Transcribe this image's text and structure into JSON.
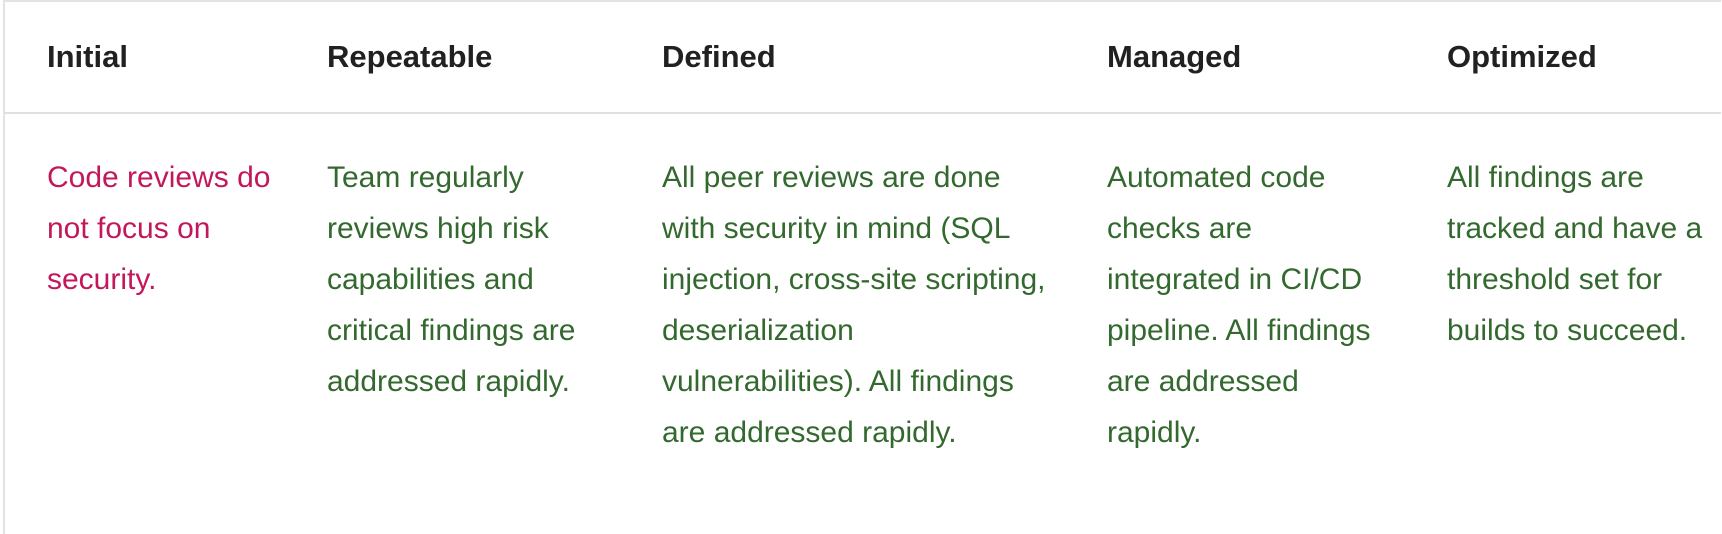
{
  "columns": [
    {
      "key": "initial",
      "header": "Initial"
    },
    {
      "key": "repeatable",
      "header": "Repeatable"
    },
    {
      "key": "defined",
      "header": "Defined"
    },
    {
      "key": "managed",
      "header": "Managed"
    },
    {
      "key": "optimized",
      "header": "Optimized"
    }
  ],
  "row": {
    "initial": "Code reviews do not focus on security.",
    "repeatable": "Team regularly reviews high risk capabilities and critical findings are addressed rapidly.",
    "defined": "All peer reviews are done with security in mind (SQL injection, cross-site scripting, deserialization vulnerabilities). All findings are addressed rapidly.",
    "managed": "Automated code checks are integrated in CI/CD pipeline. All findings are addressed rapidly.",
    "optimized": "All findings are tracked and have a threshold set for builds to succeed."
  },
  "colors": {
    "header_text": "#212121",
    "initial_text": "#c2185b",
    "level_text": "#33692e",
    "border": "#e0e0e0"
  }
}
